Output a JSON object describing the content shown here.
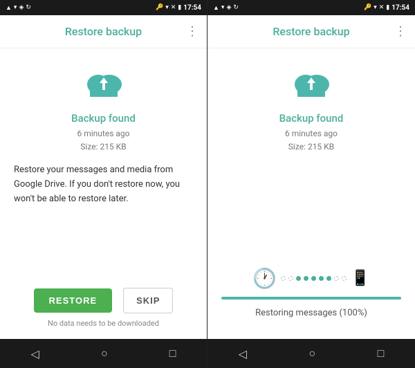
{
  "left_screen": {
    "status": {
      "time": "17:54"
    },
    "app_bar": {
      "title": "Restore backup",
      "menu_icon": "⋮"
    },
    "content": {
      "backup_status": "Backup found",
      "backup_time": "6 minutes ago",
      "backup_size": "Size: 215 KB",
      "description": "Restore your messages and media from Google Drive. If you don't restore now, you won't be able to restore later."
    },
    "buttons": {
      "restore": "RESTORE",
      "skip": "SKIP"
    },
    "footer_note": "No data needs to be downloaded"
  },
  "right_screen": {
    "status": {
      "time": "17:54"
    },
    "app_bar": {
      "title": "Restore backup",
      "menu_icon": "⋮"
    },
    "content": {
      "backup_status": "Backup found",
      "backup_time": "6 minutes ago",
      "backup_size": "Size: 215 KB"
    },
    "progress": {
      "progress_percent": 100,
      "progress_label": "Restoring messages (100%)"
    }
  },
  "nav_icons": {
    "back": "◁",
    "home": "○",
    "recent": "□"
  }
}
